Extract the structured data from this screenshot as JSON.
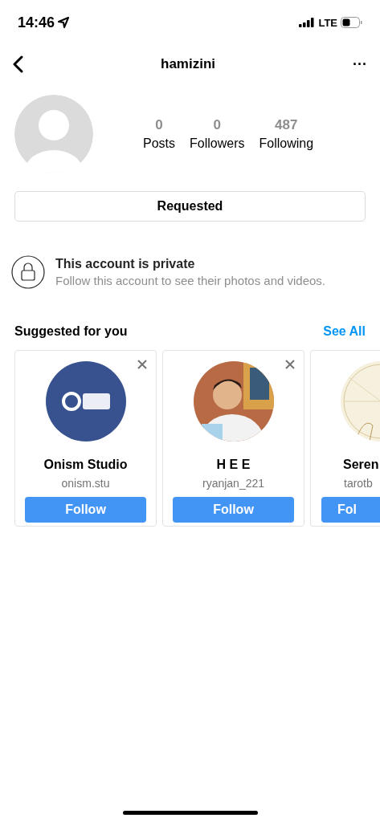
{
  "status_bar": {
    "time": "14:46",
    "network": "LTE"
  },
  "nav": {
    "username": "hamizini",
    "more": "···"
  },
  "profile": {
    "stats": [
      {
        "value": "0",
        "label": "Posts"
      },
      {
        "value": "0",
        "label": "Followers"
      },
      {
        "value": "487",
        "label": "Following"
      }
    ],
    "button": "Requested"
  },
  "private_notice": {
    "title": "This account is private",
    "text": "Follow this account to see their photos and videos."
  },
  "suggested": {
    "title": "Suggested for you",
    "see_all": "See All",
    "cards": [
      {
        "name": "Onism Studio",
        "handle": "onism.stu",
        "button": "Follow",
        "dismissable": true
      },
      {
        "name": "H E E",
        "handle": "ryanjan_221",
        "button": "Follow",
        "dismissable": true
      },
      {
        "name": "Seren",
        "handle": "tarotb",
        "button": "Fol",
        "dismissable": false
      }
    ]
  }
}
